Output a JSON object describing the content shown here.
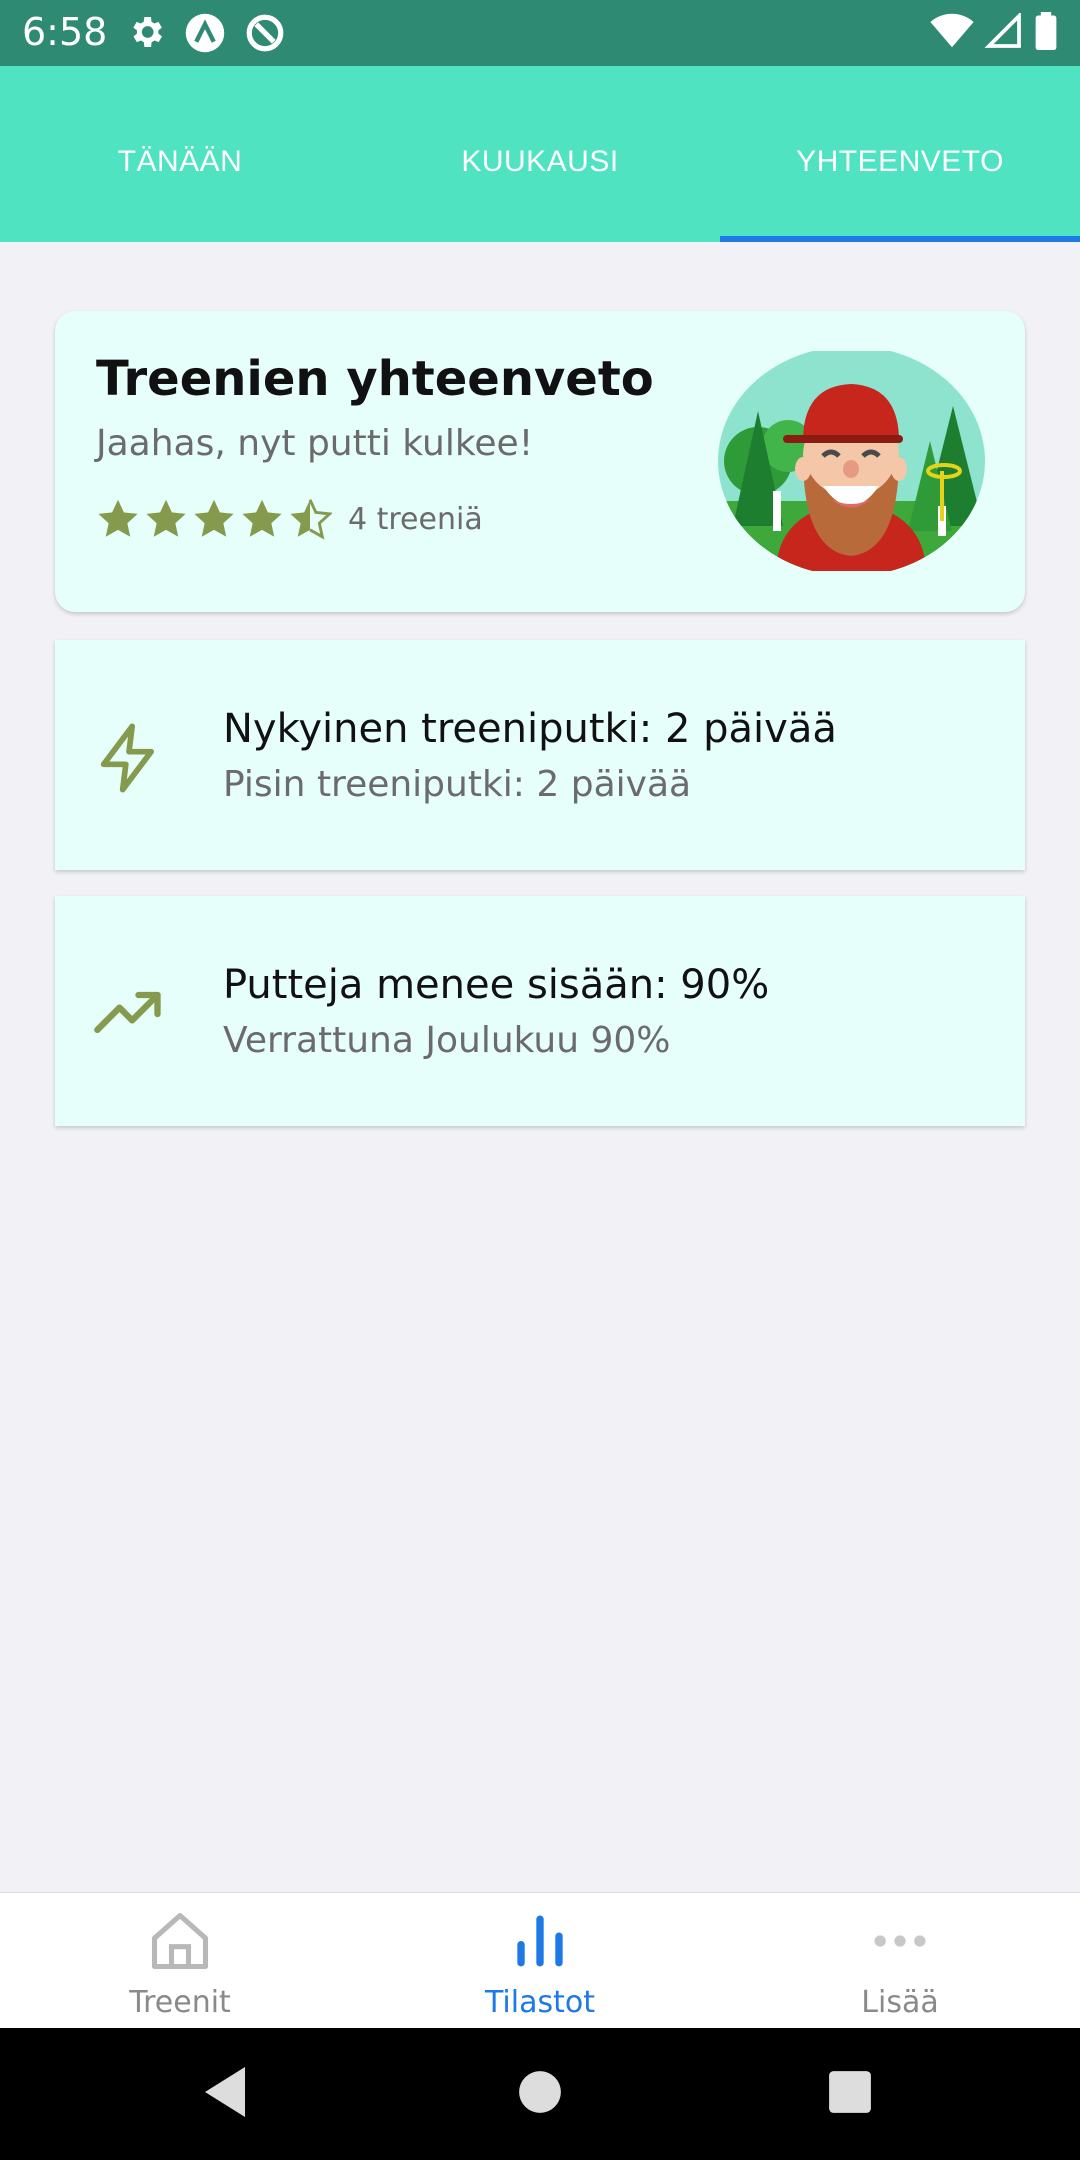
{
  "status_bar": {
    "time": "6:58"
  },
  "tabs": [
    {
      "label": "TÄNÄÄN",
      "active": false
    },
    {
      "label": "KUUKAUSI",
      "active": false
    },
    {
      "label": "YHTEENVETO",
      "active": true
    }
  ],
  "summary": {
    "title": "Treenien yhteenveto",
    "subtitle": "Jaahas, nyt putti kulkee!",
    "rating": 4.5,
    "rating_max": 5,
    "count_text": "4 treeniä"
  },
  "stats": [
    {
      "icon": "lightning-icon",
      "main": "Nykyinen treeniputki: 2 päivää",
      "sub": "Pisin treeniputki: 2 päivää"
    },
    {
      "icon": "trending-up-icon",
      "main": "Putteja menee sisään: 90%",
      "sub": "Verrattuna Joulukuu 90%"
    }
  ],
  "bottom_nav": [
    {
      "label": "Treenit",
      "icon": "home-icon",
      "active": false
    },
    {
      "label": "Tilastot",
      "icon": "bar-chart-icon",
      "active": true
    },
    {
      "label": "Lisää",
      "icon": "more-dots-icon",
      "active": false
    }
  ],
  "colors": {
    "header": "#50e3c2",
    "status_bar": "#2e8a72",
    "accent": "#1e78e6",
    "icon_green": "#869a4e",
    "card_bg": "#e6fffb"
  }
}
